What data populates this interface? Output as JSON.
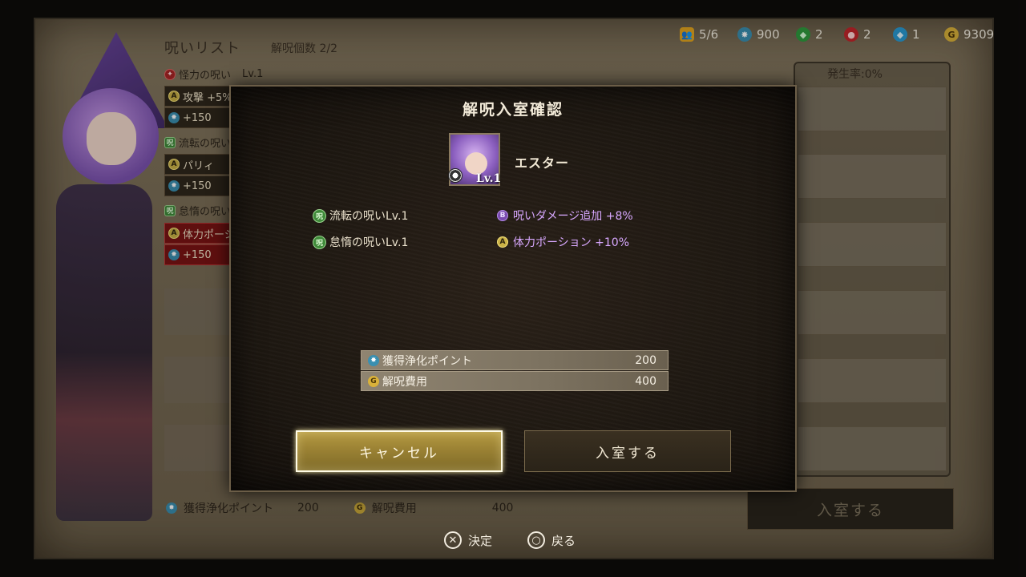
{
  "hud": {
    "party": "5/6",
    "purify_points": "900",
    "green_gems": "2",
    "red_gems": "2",
    "blue_gems": "1",
    "gold": "9309"
  },
  "background": {
    "list_title": "呪いリスト",
    "list_count": "解呪個数 2/2",
    "curse_rows": [
      {
        "name": "怪力の呪い",
        "level": "Lv.1",
        "stat": "攻撃 +5%",
        "points": "+150"
      },
      {
        "name": "流転の呪い",
        "level": "",
        "stat": "パリィ",
        "points": "+150"
      },
      {
        "name": "怠惰の呪い",
        "level": "",
        "stat": "体力ポーシ",
        "points": "+150"
      }
    ],
    "rate": "発生率:0%",
    "bottom_points_label": "獲得浄化ポイント",
    "bottom_points_value": "200",
    "bottom_cost_label": "解呪費用",
    "bottom_cost_value": "400",
    "bottom_enter": "入室する"
  },
  "modal": {
    "title": "解呪入室確認",
    "character_name": "エスター",
    "character_level": "Lv.1",
    "curses": [
      {
        "label": "流転の呪いLv.1",
        "icon": "green-curse-icon"
      },
      {
        "label": "怠惰の呪いLv.1",
        "icon": "green-curse-icon"
      }
    ],
    "effects": [
      {
        "badge": "B",
        "label": "呪いダメージ追加 +8%",
        "color": "#7a4bb0"
      },
      {
        "badge": "A",
        "label": "体力ポーション +10%",
        "color": "#c9b146"
      }
    ],
    "points_label": "獲得浄化ポイント",
    "points_value": "200",
    "cost_label": "解呪費用",
    "cost_value": "400",
    "cancel": "キャンセル",
    "enter": "入室する"
  },
  "prompts": {
    "confirm": "決定",
    "back": "戻る"
  }
}
